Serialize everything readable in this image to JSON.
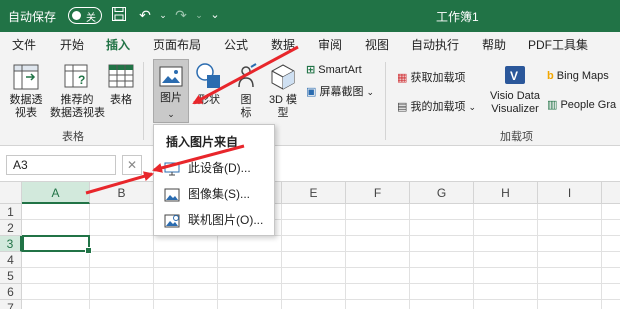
{
  "colors": {
    "brand": "#217346",
    "arrow": "#e8262b"
  },
  "titlebar": {
    "autosave_label": "自动保存",
    "autosave_state": "关",
    "title": "工作簿1"
  },
  "tabs": [
    "文件",
    "开始",
    "插入",
    "页面布局",
    "公式",
    "数据",
    "审阅",
    "视图",
    "自动执行",
    "帮助",
    "PDF工具集"
  ],
  "ribbon": {
    "tables": {
      "pivot": "数据透\n视表",
      "recommended": "推荐的\n数据透视表",
      "table": "表格",
      "group_label": "表格"
    },
    "illustrations": {
      "picture": "图片",
      "shapes": "形状",
      "icons": "图\n标",
      "models_3d": "3D 模\n型",
      "smartart": "SmartArt",
      "screenshot": "屏幕截图"
    },
    "addins": {
      "get_addins": "获取加载项",
      "my_addins": "我的加载项",
      "visio": "Visio Data\nVisualizer",
      "bing_maps": "Bing Maps",
      "people_graph": "People Gra",
      "group_label": "加载项"
    }
  },
  "formula_bar": {
    "name_box": "A3",
    "fx": "✕"
  },
  "grid": {
    "columns": [
      "A",
      "B",
      "C",
      "D",
      "E",
      "F",
      "G",
      "H",
      "I"
    ],
    "rows": [
      "1",
      "2",
      "3",
      "4",
      "5",
      "6",
      "7"
    ],
    "active_cell": "A3"
  },
  "picture_menu": {
    "header": "插入图片来自",
    "items": [
      "此设备(D)...",
      "图像集(S)...",
      "联机图片(O)..."
    ]
  }
}
